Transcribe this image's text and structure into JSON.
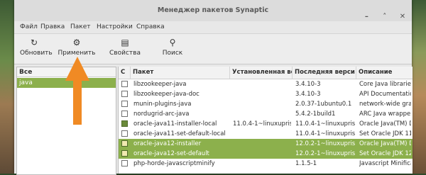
{
  "window": {
    "title": "Менеджер пакетов Synaptic"
  },
  "menu": [
    "Файл",
    "Правка",
    "Пакет",
    "Настройки",
    "Справка"
  ],
  "toolbar": {
    "refresh_label": "Обновить",
    "apply_label": "Применить",
    "properties_label": "Свойства",
    "search_label": "Поиск"
  },
  "sidebar": {
    "header": "Все",
    "selected": "java"
  },
  "table": {
    "headers": [
      "С",
      "Пакет",
      "Установленная ве",
      "Последняя верси",
      "Описание"
    ],
    "rows": [
      {
        "name": "libzookeeper-java",
        "installed": "",
        "latest": "3.4.10-3",
        "desc": "Core Java libraries",
        "status": "empty",
        "selected": false
      },
      {
        "name": "libzookeeper-java-doc",
        "installed": "",
        "latest": "3.4.10-3",
        "desc": "API Documentation",
        "status": "empty",
        "selected": false
      },
      {
        "name": "munin-plugins-java",
        "installed": "",
        "latest": "2.0.37-1ubuntu0.1",
        "desc": "network-wide grap",
        "status": "empty",
        "selected": false
      },
      {
        "name": "nordugrid-arc-java",
        "installed": "",
        "latest": "5.4.2-1build1",
        "desc": "ARC Java wrappers",
        "status": "empty",
        "selected": false
      },
      {
        "name": "oracle-java11-installer-local",
        "installed": "11.0.4-1~linuxuprisi",
        "latest": "11.0.4-1~linuxupris",
        "desc": "Oracle Java(TM) De",
        "status": "installed",
        "selected": false
      },
      {
        "name": "oracle-java11-set-default-local",
        "installed": "",
        "latest": "11.0.4-1~linuxupris",
        "desc": "Set Oracle JDK 11",
        "status": "empty",
        "selected": false
      },
      {
        "name": "oracle-java12-installer",
        "installed": "",
        "latest": "12.0.2-1~linuxupris",
        "desc": "Oracle Java(TM) De",
        "status": "upgrade",
        "selected": true
      },
      {
        "name": "oracle-java12-set-default",
        "installed": "",
        "latest": "12.0.2-1~linuxupris",
        "desc": "Set Oracle JDK 12",
        "status": "upgrade",
        "selected": true
      },
      {
        "name": "php-horde-javascriptminify",
        "installed": "",
        "latest": "1.1.5-1",
        "desc": "Javascript Minifica",
        "status": "empty",
        "selected": false
      }
    ]
  },
  "colors": {
    "accent": "#8cb04c",
    "annotation_arrow": "#f08a24"
  }
}
